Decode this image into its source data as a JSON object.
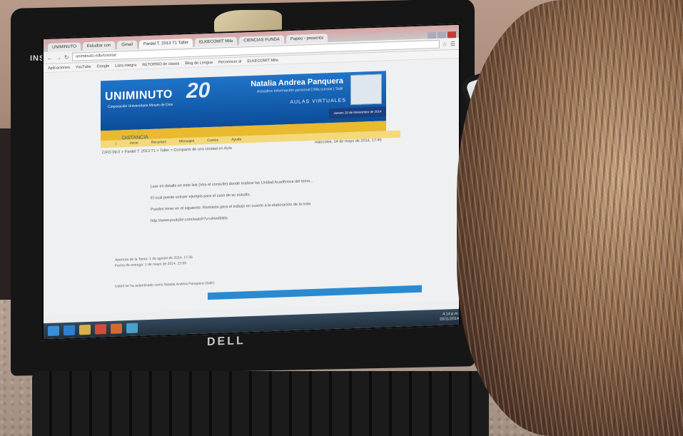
{
  "laptop": {
    "brand": "INSPIRON",
    "logo": "DELL"
  },
  "browser": {
    "tabs": [
      {
        "label": "UNIMINUTO"
      },
      {
        "label": "Estudiar con"
      },
      {
        "label": "Gmail"
      },
      {
        "label": "Pardel T. 2013 T1 Taller",
        "active": true
      },
      {
        "label": "ELKECOMIT Mila"
      },
      {
        "label": "CIENCIAS FUNDA"
      },
      {
        "label": "Papeo - presenta"
      }
    ],
    "url": "uniminuto.edu/course",
    "bookmarks": [
      "Aplicaciones",
      "YouTube",
      "Google",
      "Lista integra",
      "RETORNO de clases",
      "Blog de Lengua",
      "Reconocer al",
      "ELKECOMIT Mila"
    ]
  },
  "site": {
    "logo": "UNIMINUTO",
    "logo_sub": "Corporación Universitaria Minuto de Dios",
    "anniversary": "20",
    "user_name": "Natalia Andrea Panquera",
    "user_menu": "Actualice información personal  |  Mis cursos  |  Salir",
    "aulas": "AULAS VIRTUALES",
    "date_box": "Jueves 20 de Noviembre de 2014",
    "section": "DISTANCIA",
    "menu": [
      "Inicio",
      "Recursos",
      "Mensajes",
      "Cursos",
      "Ayuda"
    ],
    "breadcrumb": "CIFD 09-0 > Pardel T. 2013 T1 > Taller > Compartir de una Unidad en Aula",
    "side_date": "miércoles, 14 de mayo de 2014, 17:45",
    "content_lines": [
      "Leer en detalle en este link (Vea el consulte) donde realizar las Unidad Académica del tema...",
      "El cual puede extraer ejemplo para el caso de su estudio.",
      "Puedes tener en el siguiente: Remisión para el trabajo en cuanto a la elaboración de la nota",
      "http://www.youtube.com/watch?v=xhtmlbNlo"
    ],
    "meta_lines": [
      "Apertura de la Tarea:  1 de agosto de 2014, 17:36",
      "Fecha de entrega:  1 de mayo de 2014, 23:59"
    ],
    "footer": "Usted se ha autenticado como Natalia Andrea Panquera (Salir)",
    "tray_time": "4:14 p.m.",
    "tray_date": "20/11/2014"
  }
}
